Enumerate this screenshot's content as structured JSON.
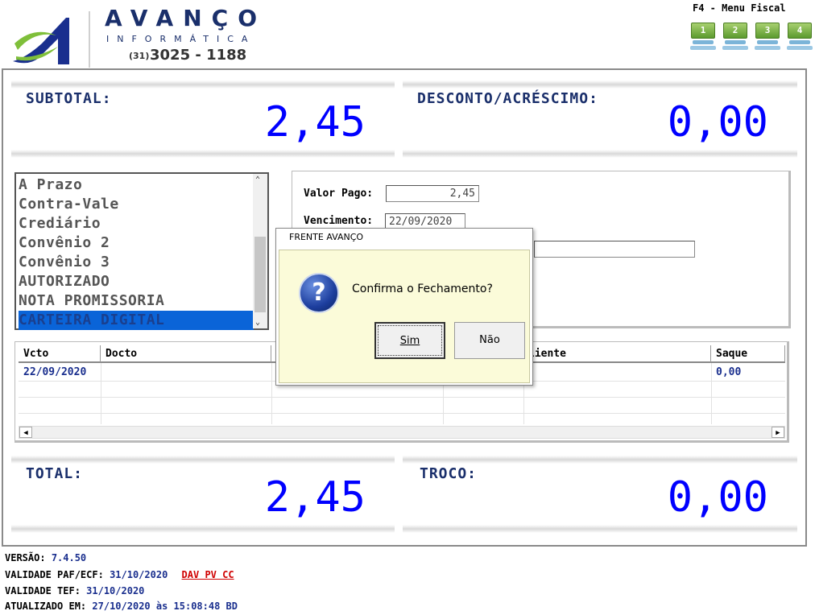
{
  "brand": {
    "name": "AVANÇO",
    "subtitle": "INFORMÁTICA",
    "phone_area": "(31)",
    "phone": "3025 - 1188"
  },
  "menu_fiscal": {
    "label": "F4 - Menu Fiscal",
    "keys": [
      "1",
      "2",
      "3",
      "4"
    ]
  },
  "totals": {
    "subtotal_label": "SUBTOTAL:",
    "subtotal_value": "2,45",
    "desconto_label": "DESCONTO/ACRÉSCIMO:",
    "desconto_value": "0,00",
    "total_label": "TOTAL:",
    "total_value": "2,45",
    "troco_label": "TROCO:",
    "troco_value": "0,00"
  },
  "payment_methods": {
    "items": [
      "A Prazo",
      "Contra-Vale",
      "Crediário",
      "Convênio 2",
      "Convênio 3",
      "AUTORIZADO",
      "NOTA PROMISSORIA",
      "CARTEIRA DIGITAL"
    ],
    "selected": "CARTEIRA DIGITAL"
  },
  "payment_info": {
    "valor_pago_label": "Valor Pago:",
    "valor_pago_value": "2,45",
    "vencimento_label": "Vencimento:",
    "vencimento_value": "22/09/2020"
  },
  "grid": {
    "columns": [
      "Vcto",
      "Docto",
      "liente",
      "Saque"
    ],
    "row": {
      "vcto": "22/09/2020",
      "saque": "0,00"
    }
  },
  "dialog": {
    "title": "FRENTE AVANÇO",
    "message": "Confirma o Fechamento?",
    "yes_label": "Sim",
    "no_label": "Não"
  },
  "footer": {
    "versao_label": "VERSÃO:",
    "versao_value": "7.4.50",
    "validade_paf_label": "VALIDADE PAF/ECF:",
    "validade_paf_value": "31/10/2020",
    "dav_link": "DAV PV CC",
    "validade_tef_label": "VALIDADE TEF:",
    "validade_tef_value": "31/10/2020",
    "atualizado_label": "ATUALIZADO EM:",
    "atualizado_value": "27/10/2020 às 15:08:48 BD"
  },
  "colors": {
    "value_blue": "#0000ff",
    "label_navy": "#1a2f6b",
    "selection": "#0a64d8",
    "dialog_bg": "#fbfbd9",
    "link_red": "#d00000"
  }
}
